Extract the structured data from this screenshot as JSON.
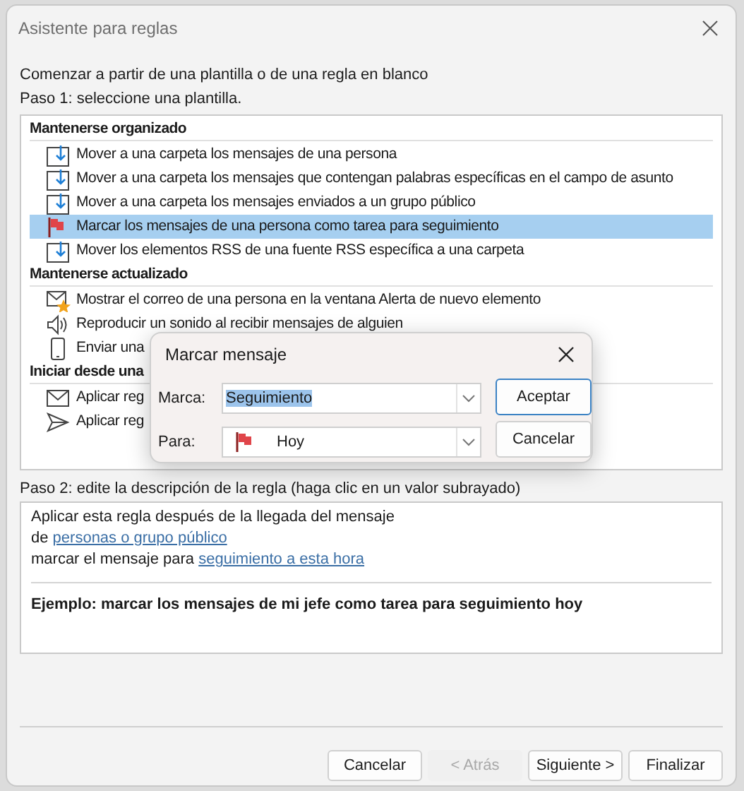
{
  "window": {
    "title": "Asistente para reglas"
  },
  "intro": "Comenzar a partir de una plantilla o de una regla en blanco",
  "step1_label": "Paso 1: seleccione una plantilla.",
  "template_groups": [
    {
      "title": "Mantenerse organizado",
      "items": [
        {
          "label": "Mover a una carpeta los mensajes de una persona",
          "kind": "move",
          "selected": false
        },
        {
          "label": "Mover a una carpeta los mensajes que contengan palabras específicas en el campo de asunto",
          "kind": "move",
          "selected": false
        },
        {
          "label": "Mover a una carpeta los mensajes enviados a un grupo público",
          "kind": "move",
          "selected": false
        },
        {
          "label": "Marcar los mensajes de una persona como tarea para seguimiento",
          "kind": "flag",
          "selected": true
        },
        {
          "label": "Mover los elementos RSS de una fuente RSS específica a una carpeta",
          "kind": "move",
          "selected": false
        }
      ]
    },
    {
      "title": "Mantenerse actualizado",
      "items": [
        {
          "label": "Mostrar el correo de una persona en la ventana Alerta de nuevo elemento",
          "kind": "alert",
          "selected": false
        },
        {
          "label": "Reproducir un sonido al recibir mensajes de alguien",
          "kind": "sound",
          "selected": false
        },
        {
          "label": "Enviar una",
          "kind": "phone",
          "selected": false
        }
      ]
    },
    {
      "title": "Iniciar desde una",
      "items": [
        {
          "label": "Aplicar reg",
          "kind": "mail",
          "selected": false
        },
        {
          "label": "Aplicar reg",
          "kind": "send",
          "selected": false
        }
      ]
    }
  ],
  "flag_dialog": {
    "title": "Marcar mensaje",
    "fields": [
      {
        "label": "Marca:",
        "value": "Seguimiento",
        "highlighted": true,
        "kind": "text"
      },
      {
        "label": "Para:",
        "value": "Hoy",
        "highlighted": false,
        "kind": "flag"
      }
    ],
    "buttons": [
      {
        "label": "Aceptar",
        "default": true
      },
      {
        "label": "Cancelar",
        "default": false
      }
    ]
  },
  "step2_label": "Paso 2: edite la descripción de la regla (haga clic en un valor subrayado)",
  "description": [
    [
      {
        "text": "Aplicar esta regla después de la llegada del mensaje",
        "kind": "text"
      }
    ],
    [
      {
        "text": "de ",
        "kind": "text"
      },
      {
        "text": "personas o grupo público",
        "kind": "link"
      }
    ],
    [
      {
        "text": "marcar el mensaje para ",
        "kind": "text"
      },
      {
        "text": "seguimiento a esta hora",
        "kind": "link"
      }
    ]
  ],
  "example": "Ejemplo: marcar los mensajes de mi jefe como tarea para seguimiento hoy",
  "buttons": [
    {
      "label": "Cancelar",
      "disabled": false
    },
    {
      "label": "< Atrás",
      "disabled": true
    },
    {
      "label": "Siguiente >",
      "disabled": false
    },
    {
      "label": "Finalizar",
      "disabled": false
    }
  ]
}
